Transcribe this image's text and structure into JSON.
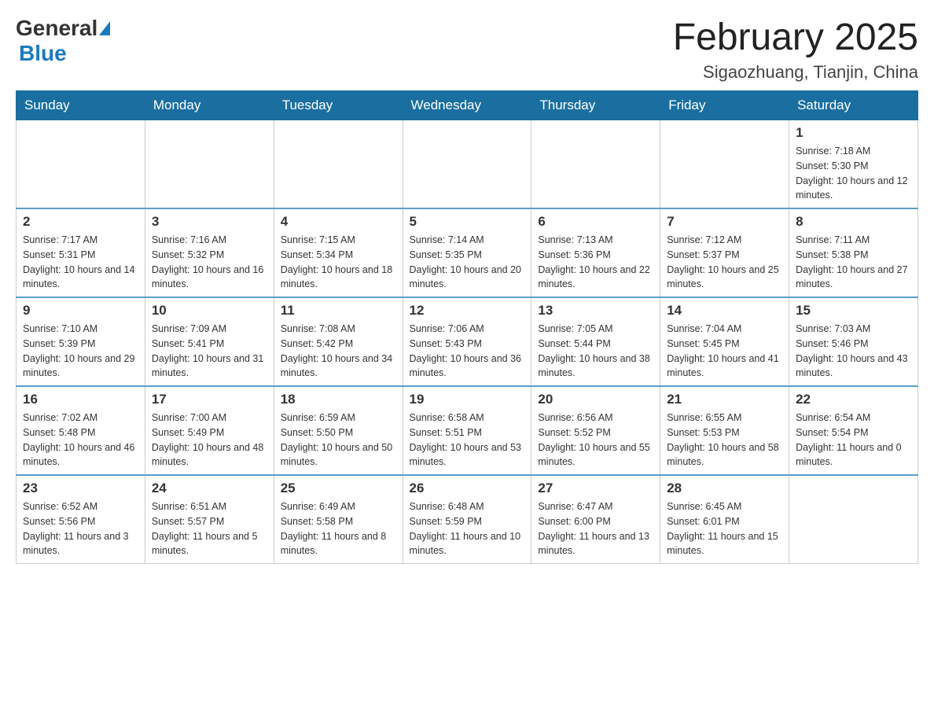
{
  "header": {
    "logo_general": "General",
    "logo_blue": "Blue",
    "month_title": "February 2025",
    "location": "Sigaozhuang, Tianjin, China"
  },
  "days_of_week": [
    "Sunday",
    "Monday",
    "Tuesday",
    "Wednesday",
    "Thursday",
    "Friday",
    "Saturday"
  ],
  "weeks": [
    [
      {
        "day": "",
        "info": ""
      },
      {
        "day": "",
        "info": ""
      },
      {
        "day": "",
        "info": ""
      },
      {
        "day": "",
        "info": ""
      },
      {
        "day": "",
        "info": ""
      },
      {
        "day": "",
        "info": ""
      },
      {
        "day": "1",
        "info": "Sunrise: 7:18 AM\nSunset: 5:30 PM\nDaylight: 10 hours and 12 minutes."
      }
    ],
    [
      {
        "day": "2",
        "info": "Sunrise: 7:17 AM\nSunset: 5:31 PM\nDaylight: 10 hours and 14 minutes."
      },
      {
        "day": "3",
        "info": "Sunrise: 7:16 AM\nSunset: 5:32 PM\nDaylight: 10 hours and 16 minutes."
      },
      {
        "day": "4",
        "info": "Sunrise: 7:15 AM\nSunset: 5:34 PM\nDaylight: 10 hours and 18 minutes."
      },
      {
        "day": "5",
        "info": "Sunrise: 7:14 AM\nSunset: 5:35 PM\nDaylight: 10 hours and 20 minutes."
      },
      {
        "day": "6",
        "info": "Sunrise: 7:13 AM\nSunset: 5:36 PM\nDaylight: 10 hours and 22 minutes."
      },
      {
        "day": "7",
        "info": "Sunrise: 7:12 AM\nSunset: 5:37 PM\nDaylight: 10 hours and 25 minutes."
      },
      {
        "day": "8",
        "info": "Sunrise: 7:11 AM\nSunset: 5:38 PM\nDaylight: 10 hours and 27 minutes."
      }
    ],
    [
      {
        "day": "9",
        "info": "Sunrise: 7:10 AM\nSunset: 5:39 PM\nDaylight: 10 hours and 29 minutes."
      },
      {
        "day": "10",
        "info": "Sunrise: 7:09 AM\nSunset: 5:41 PM\nDaylight: 10 hours and 31 minutes."
      },
      {
        "day": "11",
        "info": "Sunrise: 7:08 AM\nSunset: 5:42 PM\nDaylight: 10 hours and 34 minutes."
      },
      {
        "day": "12",
        "info": "Sunrise: 7:06 AM\nSunset: 5:43 PM\nDaylight: 10 hours and 36 minutes."
      },
      {
        "day": "13",
        "info": "Sunrise: 7:05 AM\nSunset: 5:44 PM\nDaylight: 10 hours and 38 minutes."
      },
      {
        "day": "14",
        "info": "Sunrise: 7:04 AM\nSunset: 5:45 PM\nDaylight: 10 hours and 41 minutes."
      },
      {
        "day": "15",
        "info": "Sunrise: 7:03 AM\nSunset: 5:46 PM\nDaylight: 10 hours and 43 minutes."
      }
    ],
    [
      {
        "day": "16",
        "info": "Sunrise: 7:02 AM\nSunset: 5:48 PM\nDaylight: 10 hours and 46 minutes."
      },
      {
        "day": "17",
        "info": "Sunrise: 7:00 AM\nSunset: 5:49 PM\nDaylight: 10 hours and 48 minutes."
      },
      {
        "day": "18",
        "info": "Sunrise: 6:59 AM\nSunset: 5:50 PM\nDaylight: 10 hours and 50 minutes."
      },
      {
        "day": "19",
        "info": "Sunrise: 6:58 AM\nSunset: 5:51 PM\nDaylight: 10 hours and 53 minutes."
      },
      {
        "day": "20",
        "info": "Sunrise: 6:56 AM\nSunset: 5:52 PM\nDaylight: 10 hours and 55 minutes."
      },
      {
        "day": "21",
        "info": "Sunrise: 6:55 AM\nSunset: 5:53 PM\nDaylight: 10 hours and 58 minutes."
      },
      {
        "day": "22",
        "info": "Sunrise: 6:54 AM\nSunset: 5:54 PM\nDaylight: 11 hours and 0 minutes."
      }
    ],
    [
      {
        "day": "23",
        "info": "Sunrise: 6:52 AM\nSunset: 5:56 PM\nDaylight: 11 hours and 3 minutes."
      },
      {
        "day": "24",
        "info": "Sunrise: 6:51 AM\nSunset: 5:57 PM\nDaylight: 11 hours and 5 minutes."
      },
      {
        "day": "25",
        "info": "Sunrise: 6:49 AM\nSunset: 5:58 PM\nDaylight: 11 hours and 8 minutes."
      },
      {
        "day": "26",
        "info": "Sunrise: 6:48 AM\nSunset: 5:59 PM\nDaylight: 11 hours and 10 minutes."
      },
      {
        "day": "27",
        "info": "Sunrise: 6:47 AM\nSunset: 6:00 PM\nDaylight: 11 hours and 13 minutes."
      },
      {
        "day": "28",
        "info": "Sunrise: 6:45 AM\nSunset: 6:01 PM\nDaylight: 11 hours and 15 minutes."
      },
      {
        "day": "",
        "info": ""
      }
    ]
  ]
}
